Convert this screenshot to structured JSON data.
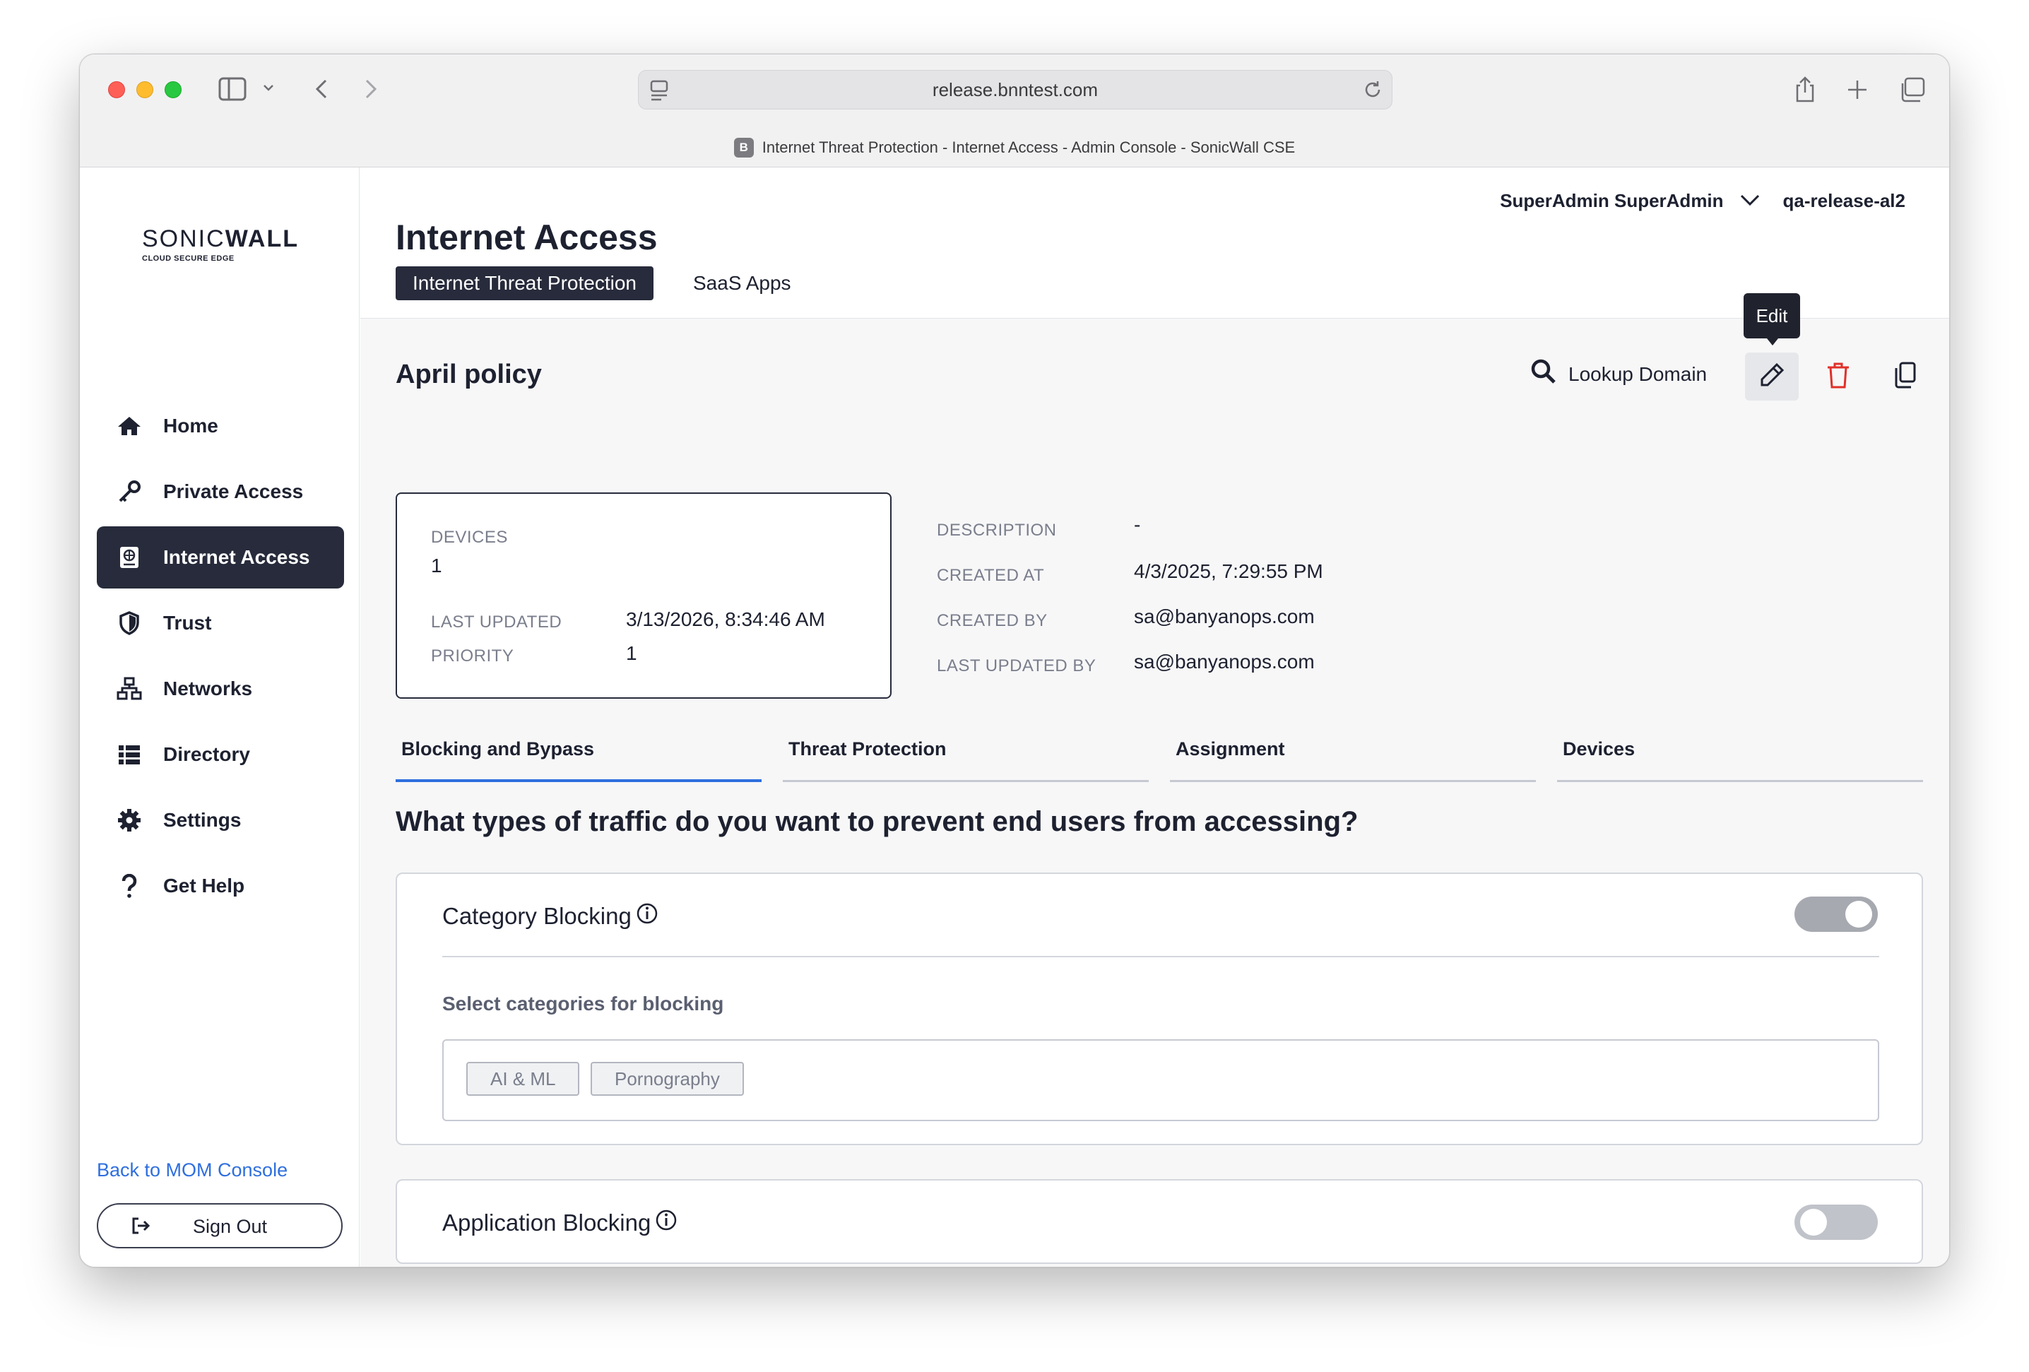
{
  "browser": {
    "url": "release.bnntest.com",
    "tab_title": "Internet Threat Protection - Internet Access - Admin Console - SonicWall CSE",
    "favicon_letter": "B"
  },
  "sidebar": {
    "brand_main": "SONIC",
    "brand_bold": "WALL",
    "brand_sub": "CLOUD SECURE EDGE",
    "items": [
      {
        "label": "Home",
        "icon": "home-icon"
      },
      {
        "label": "Private Access",
        "icon": "key-icon"
      },
      {
        "label": "Internet Access",
        "icon": "globe-icon",
        "active": true
      },
      {
        "label": "Trust",
        "icon": "shield-icon"
      },
      {
        "label": "Networks",
        "icon": "network-icon"
      },
      {
        "label": "Directory",
        "icon": "list-icon"
      },
      {
        "label": "Settings",
        "icon": "gear-icon"
      },
      {
        "label": "Get Help",
        "icon": "question-icon"
      }
    ],
    "back_link": "Back to MOM Console",
    "signout": "Sign Out"
  },
  "header": {
    "user": "SuperAdmin SuperAdmin",
    "org": "qa-release-al2",
    "title": "Internet Access",
    "subtabs": [
      "Internet Threat Protection",
      "SaaS Apps"
    ]
  },
  "policy": {
    "name": "April policy",
    "lookup_label": "Lookup Domain",
    "tooltip": "Edit",
    "devices_label": "DEVICES",
    "devices_value": "1",
    "last_updated_label": "LAST UPDATED",
    "last_updated_value": "3/13/2026, 8:34:46 AM",
    "priority_label": "PRIORITY",
    "priority_value": "1",
    "description_label": "DESCRIPTION",
    "description_value": "-",
    "created_at_label": "CREATED AT",
    "created_at_value": "4/3/2025, 7:29:55 PM",
    "created_by_label": "CREATED BY",
    "created_by_value": "sa@banyanops.com",
    "last_updated_by_label": "LAST UPDATED BY",
    "last_updated_by_value": "sa@banyanops.com"
  },
  "tabs": [
    "Blocking and Bypass",
    "Threat Protection",
    "Assignment",
    "Devices"
  ],
  "question": "What types of traffic do you want to prevent end users from accessing?",
  "category_blocking": {
    "title": "Category Blocking",
    "enabled": true,
    "select_label": "Select categories for blocking",
    "chips": [
      "AI & ML",
      "Pornography"
    ]
  },
  "application_blocking": {
    "title": "Application Blocking",
    "enabled": false
  },
  "colors": {
    "accent": "#2f6fde",
    "dark": "#272b3b",
    "danger": "#e0302a"
  }
}
